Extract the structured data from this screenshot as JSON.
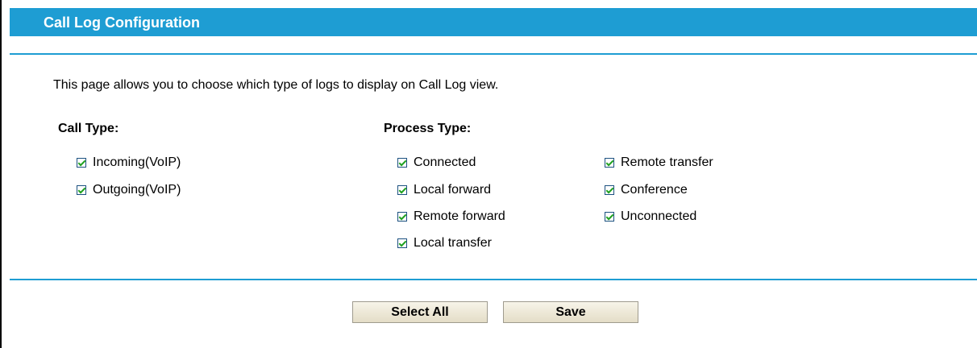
{
  "header": {
    "title": "Call Log Configuration"
  },
  "description": "This page allows you to choose which type of logs to display on Call Log view.",
  "call_type": {
    "heading": "Call Type:",
    "items": [
      {
        "label": "Incoming(VoIP)",
        "checked": true
      },
      {
        "label": "Outgoing(VoIP)",
        "checked": true
      }
    ]
  },
  "process_type": {
    "heading": "Process Type:",
    "items": [
      {
        "label": "Connected",
        "checked": true
      },
      {
        "label": "Local forward",
        "checked": true
      },
      {
        "label": "Remote forward",
        "checked": true
      },
      {
        "label": "Local transfer",
        "checked": true
      },
      {
        "label": "Remote transfer",
        "checked": true
      },
      {
        "label": "Conference",
        "checked": true
      },
      {
        "label": "Unconnected",
        "checked": true
      }
    ]
  },
  "buttons": {
    "select_all": "Select All",
    "save": "Save"
  },
  "colors": {
    "accent": "#1e9dd3",
    "checkmark": "#21a121"
  }
}
